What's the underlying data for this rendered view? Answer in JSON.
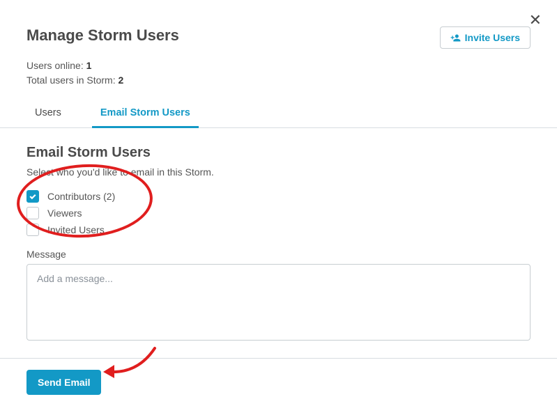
{
  "header": {
    "title": "Manage Storm Users",
    "invite_label": "Invite Users",
    "stats_online_label": "Users online: ",
    "stats_online_value": "1",
    "stats_total_label": "Total users in Storm: ",
    "stats_total_value": "2"
  },
  "tabs": {
    "users": "Users",
    "email": "Email Storm Users"
  },
  "section": {
    "title": "Email Storm Users",
    "subtitle": "Select who you'd like to email in this Storm."
  },
  "checkboxes": {
    "contributors": "Contributors (2)",
    "viewers": "Viewers",
    "invited": "Invited Users"
  },
  "message": {
    "label": "Message",
    "placeholder": "Add a message..."
  },
  "footer": {
    "send_label": "Send Email"
  }
}
